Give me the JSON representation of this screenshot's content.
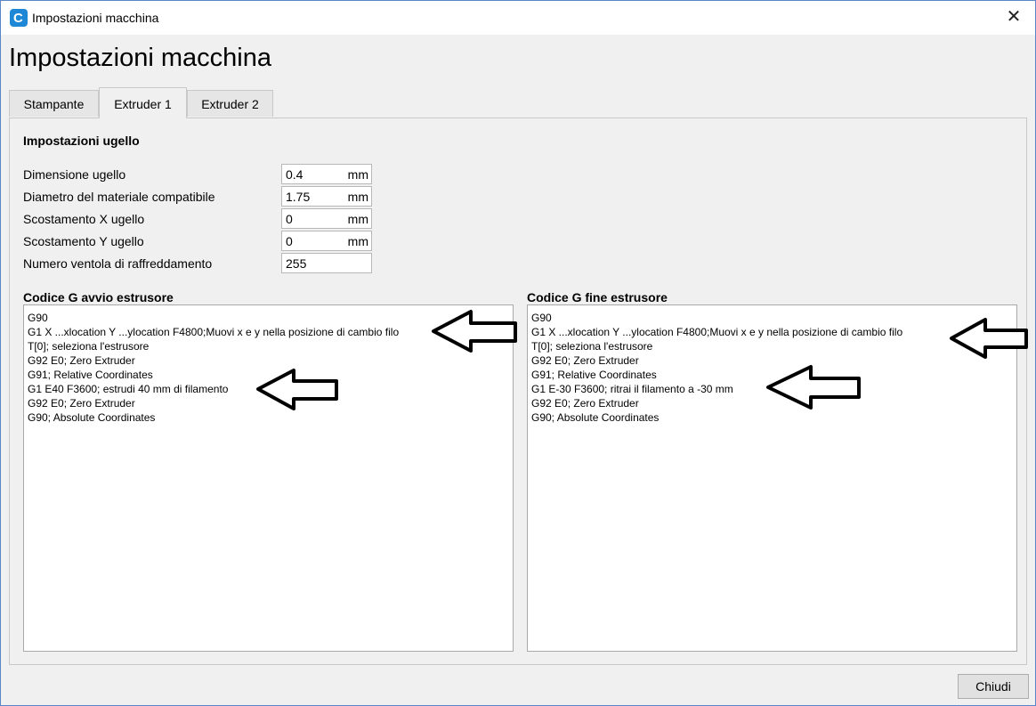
{
  "window": {
    "title": "Impostazioni macchina",
    "close_glyph": "✕",
    "app_icon": "cura-logo-icon",
    "app_icon_letter": "C"
  },
  "page_title": "Impostazioni macchina",
  "tabs": [
    {
      "label": "Stampante",
      "active": false
    },
    {
      "label": "Extruder 1",
      "active": true
    },
    {
      "label": "Extruder 2",
      "active": false
    }
  ],
  "nozzle": {
    "heading": "Impostazioni ugello",
    "fields": [
      {
        "label": "Dimensione ugello",
        "value": "0.4",
        "unit": "mm"
      },
      {
        "label": "Diametro del materiale compatibile",
        "value": "1.75",
        "unit": "mm"
      },
      {
        "label": "Scostamento X ugello",
        "value": "0",
        "unit": "mm"
      },
      {
        "label": "Scostamento Y ugello",
        "value": "0",
        "unit": "mm"
      },
      {
        "label": "Numero ventola di raffreddamento",
        "value": "255",
        "unit": ""
      }
    ]
  },
  "start_gcode": {
    "heading": "Codice G avvio estrusore",
    "lines": [
      "G90",
      "G1 X ...xlocation Y ...ylocation F4800;Muovi x e y nella posizione di cambio filo",
      "T[0]; seleziona l'estrusore",
      "G92 E0; Zero Extruder",
      "G91; Relative Coordinates",
      "G1 E40 F3600; estrudi 40 mm di filamento",
      "G92 E0; Zero Extruder",
      "G90; Absolute Coordinates"
    ]
  },
  "end_gcode": {
    "heading": "Codice G fine estrusore",
    "lines": [
      "G90",
      "G1 X ...xlocation Y ...ylocation F4800;Muovi x e y nella posizione di cambio filo",
      "T[0]; seleziona l'estrusore",
      "G92 E0; Zero Extruder",
      "G91; Relative Coordinates",
      "G1 E-30 F3600; ritrai il filamento a -30 mm",
      "G92 E0; Zero Extruder",
      "G90; Absolute Coordinates"
    ]
  },
  "footer": {
    "close_label": "Chiudi"
  },
  "colors": {
    "accent": "#1e88d6",
    "window_bg": "#f0f0f0",
    "arrow_stroke": "#000000"
  }
}
